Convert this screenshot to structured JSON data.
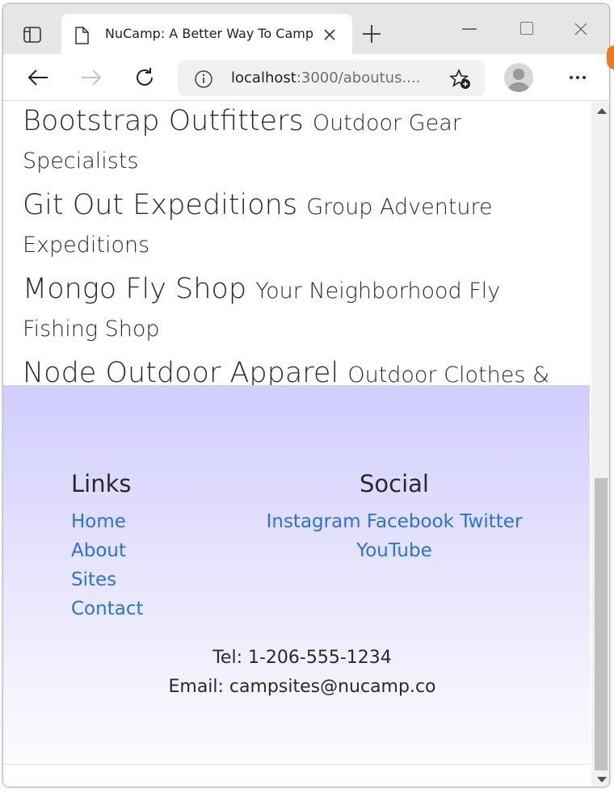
{
  "browser": {
    "tab_title": "NuCamp: A Better Way To Camp",
    "url_host": "localhost",
    "url_rest": ":3000/aboutus....",
    "colors": {
      "tabstrip": "#e6e6e6",
      "address_bar": "#f1f1f1"
    }
  },
  "partners": [
    {
      "name": "Bootstrap Outfitters",
      "tagline": "Outdoor Gear Specialists"
    },
    {
      "name": "Git Out Expeditions",
      "tagline": "Group Adventure Expeditions"
    },
    {
      "name": "Mongo Fly Shop",
      "tagline": "Your Neighborhood Fly Fishing Shop"
    },
    {
      "name": "Node Outdoor Apparel",
      "tagline": "Outdoor Clothes & Shoes"
    }
  ],
  "footer": {
    "links_heading": "Links",
    "links": [
      "Home",
      "About",
      "Sites",
      "Contact"
    ],
    "social_heading": "Social",
    "social": [
      "Instagram",
      "Facebook",
      "Twitter",
      "YouTube"
    ],
    "tel": "Tel: 1-206-555-1234",
    "email": "Email: campsites@nucamp.co",
    "colors": {
      "gradient_top": "#d1cdfe",
      "gradient_bottom": "#fbfbfe",
      "link": "#2b72d6"
    }
  }
}
